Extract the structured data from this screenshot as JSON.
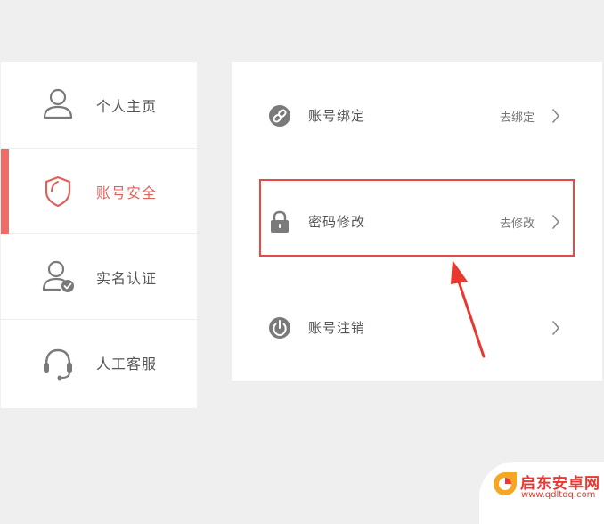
{
  "sidebar": {
    "items": [
      {
        "label": "个人主页",
        "icon": "user-icon"
      },
      {
        "label": "账号安全",
        "icon": "shield-icon",
        "active": true
      },
      {
        "label": "实名认证",
        "icon": "user-verified-icon"
      },
      {
        "label": "人工客服",
        "icon": "headset-icon"
      }
    ]
  },
  "panel": {
    "rows": [
      {
        "label": "账号绑定",
        "action": "去绑定",
        "icon": "link-icon"
      },
      {
        "label": "密码修改",
        "action": "去修改",
        "icon": "lock-icon"
      },
      {
        "label": "账号注销",
        "action": "",
        "icon": "power-icon"
      }
    ]
  },
  "watermark": {
    "title": "启东安卓网",
    "url": "www.qdltdq.com"
  },
  "colors": {
    "accent": "#ef6b66",
    "active_text": "#e0605a",
    "highlight": "#e34a48",
    "icon_gray": "#7a7a7a"
  }
}
